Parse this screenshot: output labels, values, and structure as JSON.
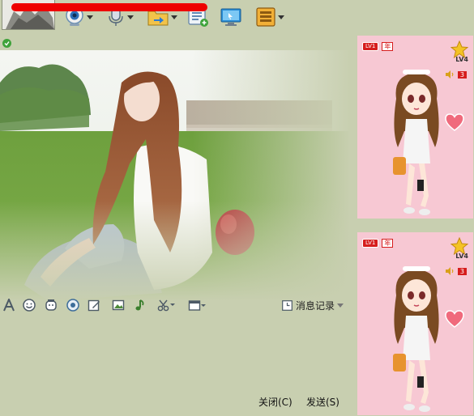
{
  "colors": {
    "window_bg": "#c8cfb0",
    "panel_pink": "#f7c8d3",
    "accent_red": "#d61d1d"
  },
  "toolbar": {
    "items": [
      {
        "icon": "webcam-icon",
        "has_dropdown": true
      },
      {
        "icon": "microphone-icon",
        "has_dropdown": true
      },
      {
        "icon": "file-transfer-icon",
        "has_dropdown": true
      },
      {
        "icon": "add-list-icon",
        "has_dropdown": false
      },
      {
        "icon": "remote-desktop-icon",
        "has_dropdown": false
      },
      {
        "icon": "apps-icon",
        "has_dropdown": true
      }
    ]
  },
  "format_toolbar": {
    "icons": [
      "font-icon",
      "emoji-icon",
      "magic-face-icon",
      "gif-icon",
      "edit-icon",
      "image-icon",
      "music-icon",
      "screenshot-icon",
      "window-shake-icon"
    ]
  },
  "history": {
    "label": "消息记录"
  },
  "buttons": {
    "close": "关闭(C)",
    "send": "发送(S)"
  },
  "panels": [
    {
      "level": "LV1",
      "year": "年",
      "lv_label": "LV4",
      "volume": "3"
    },
    {
      "level": "LV1",
      "year": "年",
      "lv_label": "LV4",
      "volume": "3"
    }
  ]
}
